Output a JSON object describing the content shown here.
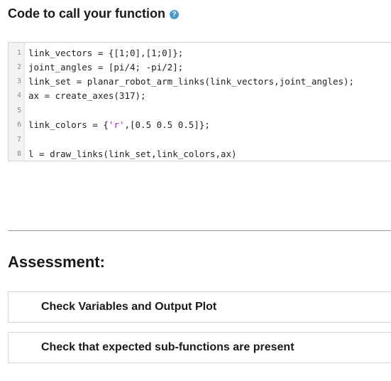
{
  "header": {
    "title": "Code to call your function",
    "help_icon": "?"
  },
  "code_editor": {
    "lines": [
      {
        "num": "1",
        "code": "link_vectors = {[1;0],[1;0]};"
      },
      {
        "num": "2",
        "code": "joint_angles = [pi/4; -pi/2];"
      },
      {
        "num": "3",
        "code": "link_set = planar_robot_arm_links(link_vectors,joint_angles);"
      },
      {
        "num": "4",
        "code": "ax = create_axes(317);"
      },
      {
        "num": "5",
        "code": ""
      },
      {
        "num": "6",
        "code_before": "link_colors = {",
        "code_string": "'r'",
        "code_after": ",[0.5 0.5 0.5]};"
      },
      {
        "num": "7",
        "code": ""
      },
      {
        "num": "8",
        "code": "l = draw_links(link_set,link_colors,ax)"
      }
    ]
  },
  "assessment": {
    "title": "Assessment:",
    "tests": [
      {
        "label": "Check Variables and Output Plot"
      },
      {
        "label": "Check that expected sub-functions are present"
      }
    ]
  },
  "colors": {
    "help_icon": "#4a9bc9",
    "string_literal": "#a020f0",
    "divider": "#9a9a9a"
  }
}
